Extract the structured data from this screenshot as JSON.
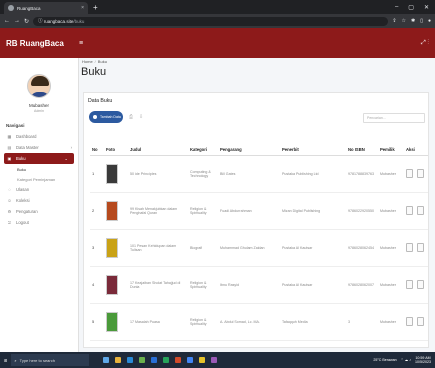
{
  "browser": {
    "tab_title": "RuangBaca",
    "tab_close": "×",
    "new_tab": "+",
    "url_host": "ruangbaca.site",
    "url_path": "/buku",
    "window_controls": [
      "–",
      "▢",
      "✕"
    ]
  },
  "app": {
    "brand": "RB RuangBaca",
    "hamburger": "≡",
    "nav_right": "⤢  ⋮",
    "accent": "#8d1a1a"
  },
  "sidebar": {
    "user_name": "Mubasher",
    "user_role": "Admin",
    "section_title": "Navigasi",
    "items": [
      {
        "icon": "▦",
        "label": "Dashboard"
      },
      {
        "icon": "▤",
        "label": "Data Master",
        "chevron": "›"
      },
      {
        "icon": "▣",
        "label": "Buku",
        "chevron": "⌄"
      }
    ],
    "submenu": [
      "Buku",
      "Kategori Peminjaman"
    ],
    "items2": [
      {
        "icon": "◌",
        "label": "Ulasan"
      },
      {
        "icon": "☺",
        "label": "Koleksi"
      },
      {
        "icon": "⚙",
        "label": "Pengaturan"
      },
      {
        "icon": "⎋",
        "label": "Logout"
      }
    ]
  },
  "main": {
    "breadcrumb": [
      "Home",
      "Buku"
    ],
    "breadcrumb_sep": "/",
    "page_title": "Buku",
    "card_title": "Data Buku",
    "add_button": "Tambah Data",
    "search_placeholder": "Pencarian..."
  },
  "table": {
    "headers": [
      "No",
      "Foto",
      "Judul",
      "Kategori",
      "Pengarang",
      "Penerbit",
      "No ISBN",
      "Pemilik",
      "Aksi"
    ],
    "rows": [
      {
        "no": "1",
        "judul": "50 ide Principles",
        "kategori": "Computing & Technology",
        "pengarang": "Bill Gates",
        "penerbit": "Pustaka Publishing Ltd",
        "isbn": "9781788839763",
        "pemilik": "Mubasher",
        "cover": "#3a3a3a"
      },
      {
        "no": "2",
        "judul": "99 Kisah Menakjubkan dalam Penghafal Quran",
        "kategori": "Religion & Spirituality",
        "pengarang": "Fuadi Abdurrahman",
        "penerbit": "Mizan Digital Publishing",
        "isbn": "9786022920550",
        "pemilik": "Mubasher",
        "cover": "#b64a1e"
      },
      {
        "no": "3",
        "judul": "101 Pesan Kehidupan dalam Tulisan",
        "kategori": "Biografi",
        "pengarang": "Muhammad Ghulam Zaidan",
        "penerbit": "Pustaka Al Kautsar",
        "isbn": "9786028062454",
        "pemilik": "Mubasher",
        "cover": "#c9a216"
      },
      {
        "no": "4",
        "judul": "17 Keajaiban Sholat Tahajjud di Dunia",
        "kategori": "Religion & Spirituality",
        "pengarang": "Ibnu Rasyid",
        "penerbit": "Pustaka Al Kautsar",
        "isbn": "9786028062007",
        "pemilik": "Mubasher",
        "cover": "#7a2a3a"
      },
      {
        "no": "5",
        "judul": "17 Masalah Puasa",
        "kategori": "Religion & Spirituality",
        "pengarang": "A. Abdul Somad, Lc. MA.",
        "penerbit": "Tafaqquh Media",
        "isbn": "3",
        "pemilik": "Mubasher",
        "cover": "#4a9a3a"
      }
    ]
  },
  "taskbar": {
    "search_placeholder": "Type here to search",
    "weather": "25°C Berawan",
    "time": "10:59 AM",
    "date": "10/5/2023"
  }
}
